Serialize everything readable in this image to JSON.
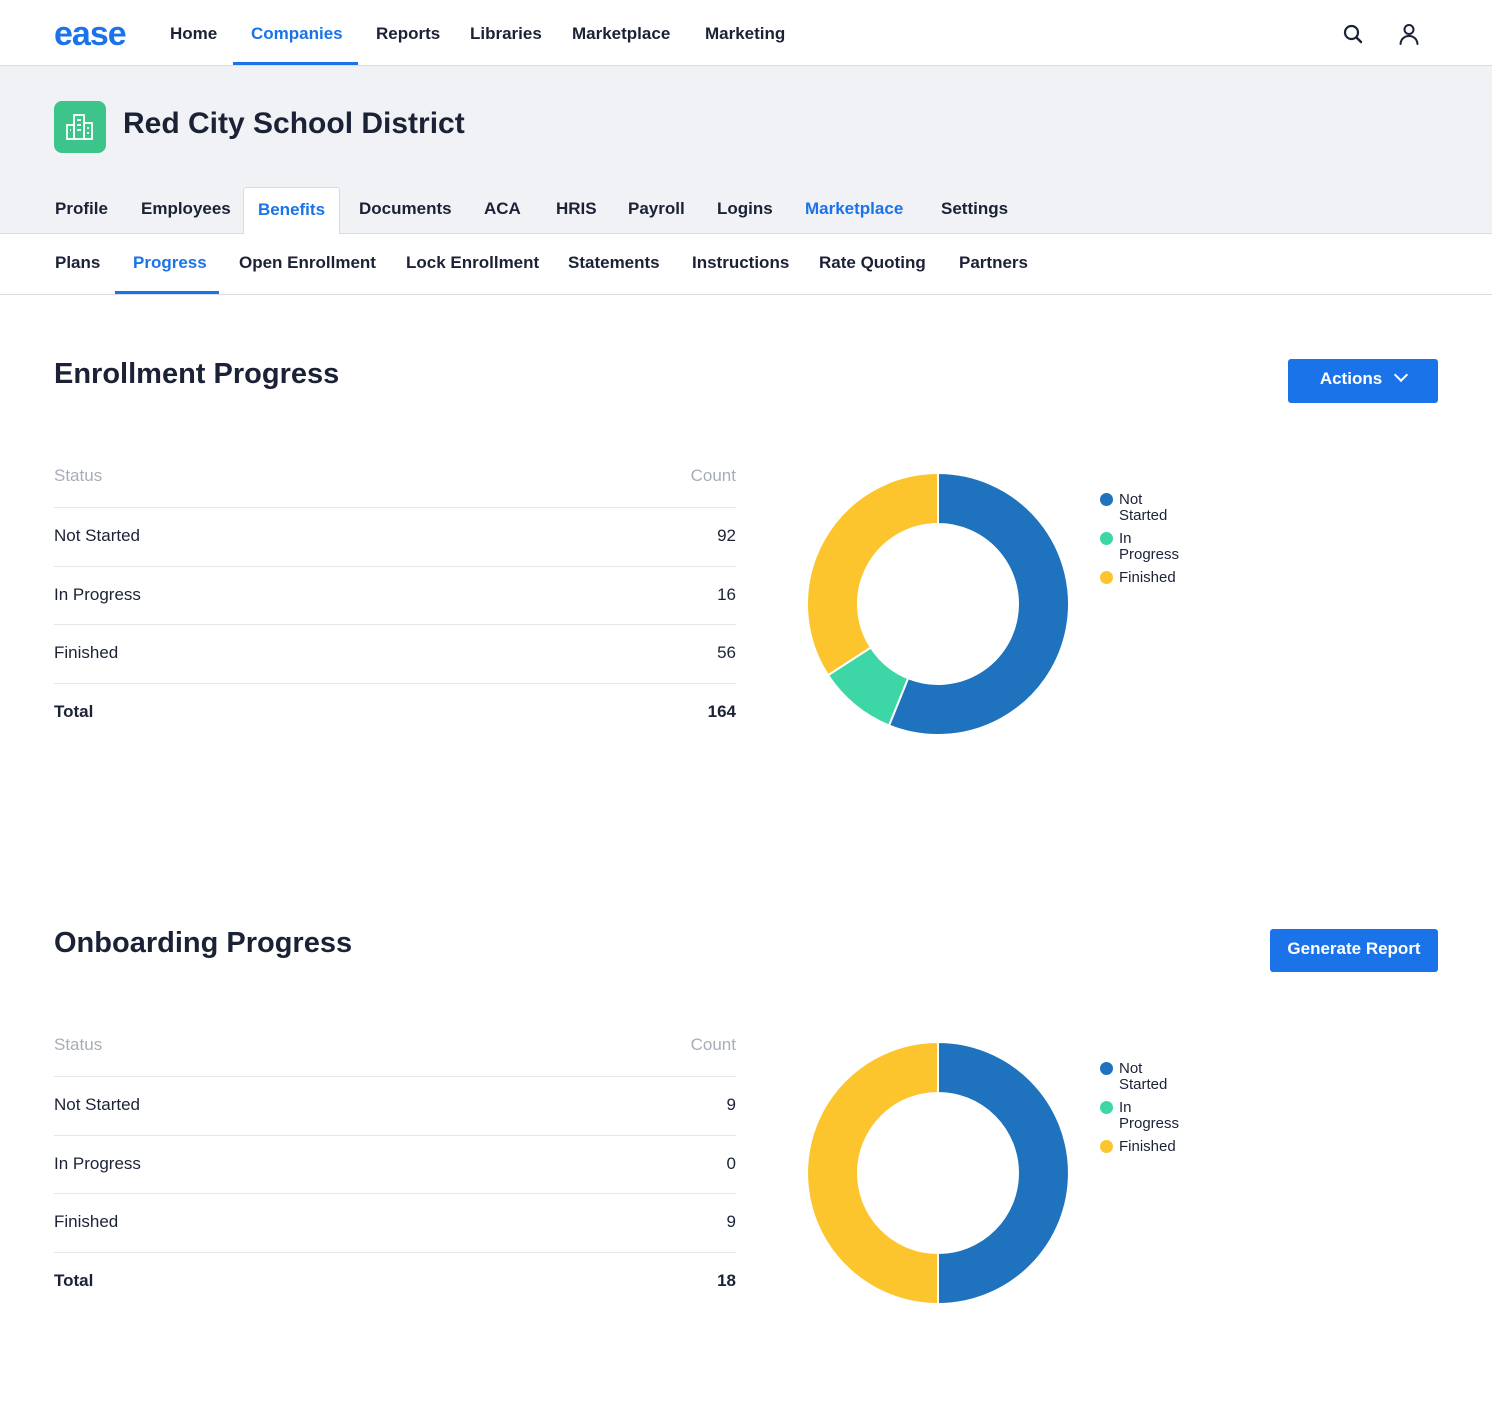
{
  "brand": {
    "logo": "ease",
    "accent": "#1a73e8"
  },
  "topnav": {
    "items": [
      "Home",
      "Companies",
      "Reports",
      "Libraries",
      "Marketplace",
      "Marketing"
    ],
    "active": "Companies"
  },
  "company": {
    "name": "Red City School District",
    "icon": "building-icon"
  },
  "tabs": {
    "items": [
      "Profile",
      "Employees",
      "Benefits",
      "Documents",
      "ACA",
      "HRIS",
      "Payroll",
      "Logins",
      "Marketplace",
      "Settings"
    ],
    "active": "Benefits"
  },
  "subnav": {
    "items": [
      "Plans",
      "Progress",
      "Open Enrollment",
      "Lock Enrollment",
      "Statements",
      "Instructions",
      "Rate Quoting",
      "Partners"
    ],
    "active": "Progress"
  },
  "colors": {
    "not_started": "#1f72be",
    "in_progress": "#3dd6a6",
    "finished": "#fcc52e"
  },
  "enrollment": {
    "title": "Enrollment Progress",
    "button": "Actions",
    "headers": {
      "status": "Status",
      "count": "Count"
    },
    "rows": [
      {
        "status": "Not Started",
        "count": "92"
      },
      {
        "status": "In Progress",
        "count": "16"
      },
      {
        "status": "Finished",
        "count": "56"
      }
    ],
    "total": {
      "label": "Total",
      "count": "164"
    },
    "legend": [
      "Not Started",
      "In Progress",
      "Finished"
    ]
  },
  "onboarding": {
    "title": "Onboarding Progress",
    "button": "Generate Report",
    "headers": {
      "status": "Status",
      "count": "Count"
    },
    "rows": [
      {
        "status": "Not Started",
        "count": "9"
      },
      {
        "status": "In Progress",
        "count": "0"
      },
      {
        "status": "Finished",
        "count": "9"
      }
    ],
    "total": {
      "label": "Total",
      "count": "18"
    },
    "legend": [
      "Not Started",
      "In Progress",
      "Finished"
    ]
  },
  "chart_data": [
    {
      "type": "pie",
      "categories": [
        "Not Started",
        "In Progress",
        "Finished"
      ],
      "values": [
        92,
        16,
        56
      ],
      "title": "",
      "legend": "right"
    },
    {
      "type": "pie",
      "categories": [
        "Not Started",
        "In Progress",
        "Finished"
      ],
      "values": [
        9,
        0,
        9
      ],
      "title": "",
      "legend": "right"
    }
  ]
}
